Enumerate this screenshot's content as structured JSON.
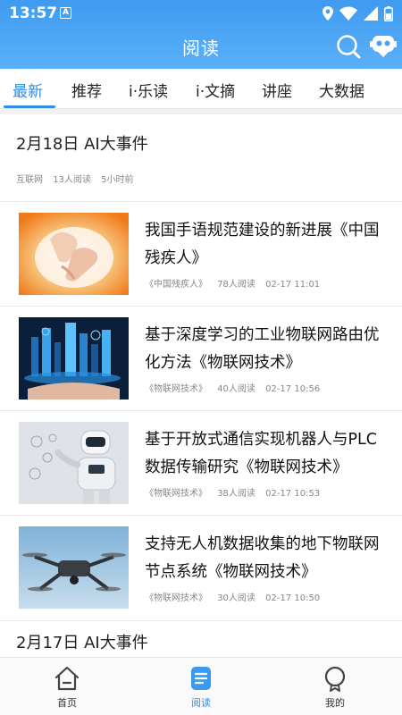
{
  "status_bar": {
    "time": "13:57",
    "notification_letter": "A"
  },
  "header": {
    "title": "阅读"
  },
  "tabs": [
    {
      "label": "最新",
      "active": true
    },
    {
      "label": "推荐",
      "active": false
    },
    {
      "label": "i·乐读",
      "active": false
    },
    {
      "label": "i·文摘",
      "active": false
    },
    {
      "label": "讲座",
      "active": false
    },
    {
      "label": "大数据",
      "active": false
    }
  ],
  "sections": [
    {
      "title": "2月18日  AI大事件",
      "source": "互联网",
      "reads": "13人阅读",
      "time": "5小时前"
    },
    {
      "title": "2月17日  AI大事件"
    }
  ],
  "articles": [
    {
      "title": "我国手语规范建设的新进展《中国残疾人》",
      "source": "《中国残疾人》",
      "reads": "78人阅读",
      "time": "02-17 11:01",
      "thumb": "hands-image"
    },
    {
      "title": "基于深度学习的工业物联网路由优化方法《物联网技术》",
      "source": "《物联网技术》",
      "reads": "40人阅读",
      "time": "02-17 10:56",
      "thumb": "smart-city-image"
    },
    {
      "title": "基于开放式通信实现机器人与PLC数据传输研究《物联网技术》",
      "source": "《物联网技术》",
      "reads": "38人阅读",
      "time": "02-17 10:53",
      "thumb": "robot-image"
    },
    {
      "title": "支持无人机数据收集的地下物联网节点系统《物联网技术》",
      "source": "《物联网技术》",
      "reads": "30人阅读",
      "time": "02-17 10:50",
      "thumb": "drone-image"
    }
  ],
  "bottom_nav": [
    {
      "label": "首页",
      "icon": "home-icon",
      "active": false
    },
    {
      "label": "阅读",
      "icon": "reading-icon",
      "active": true
    },
    {
      "label": "我的",
      "icon": "profile-icon",
      "active": false
    }
  ],
  "colors": {
    "accent": "#2f8ee8",
    "header_top": "#3f9bf0",
    "header_bottom": "#5bb0f7"
  }
}
